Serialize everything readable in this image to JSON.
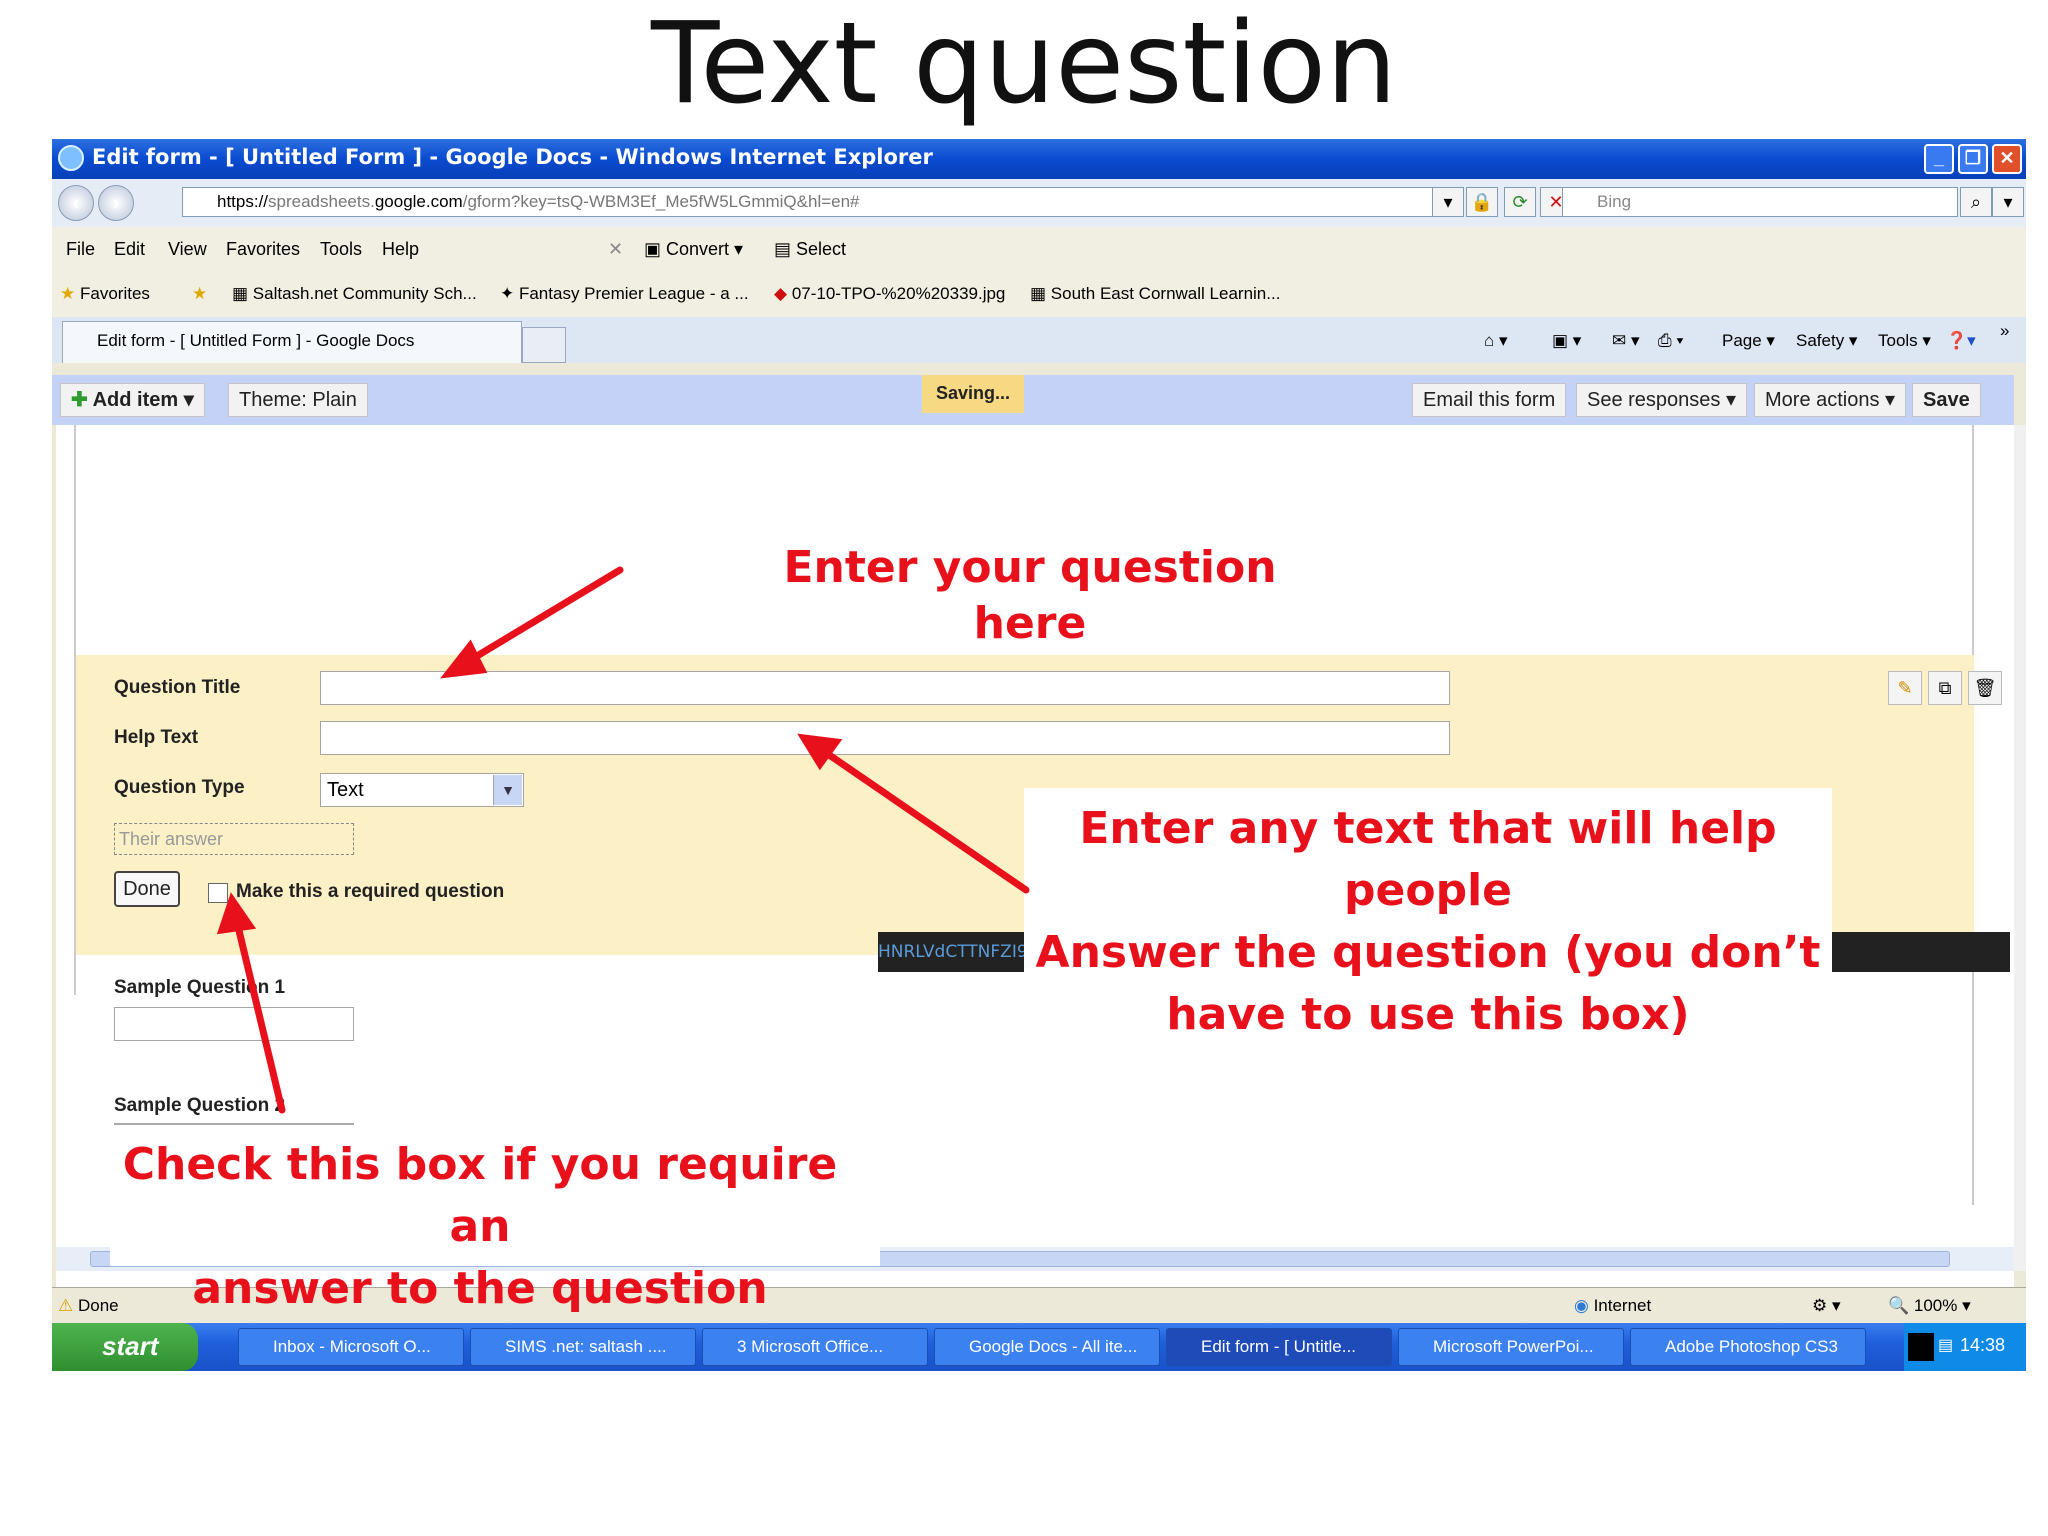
{
  "slide_title": "Text question",
  "window": {
    "title": "Edit form - [ Untitled Form ] - Google Docs - Windows Internet Explorer",
    "minimize_icon": "minimize-icon",
    "maximize_icon": "restore-icon",
    "close_icon": "close-icon"
  },
  "address": {
    "prefix": "https://",
    "host_dim": "spreadsheets.",
    "host": "google.com",
    "path": "/gform?key=tsQ-WBM3Ef_Me5fW5LGmmiQ&hl=en#",
    "search_placeholder": "Bing"
  },
  "menu": [
    "File",
    "Edit",
    "View",
    "Favorites",
    "Tools",
    "Help"
  ],
  "menu_tools": {
    "convert": "Convert",
    "select": "Select"
  },
  "favorites": {
    "label": "Favorites",
    "items": [
      "Saltash.net Community Sch...",
      "Fantasy Premier League - a ...",
      "07-10-TPO-%20%20339.jpg",
      "South East Cornwall Learnin..."
    ]
  },
  "tab": {
    "label": "Edit form - [ Untitled Form ] - Google Docs"
  },
  "command_bar": {
    "page": "Page",
    "safety": "Safety",
    "tools": "Tools"
  },
  "gd_toolbar": {
    "add_item": "Add item",
    "theme_label": "Theme:",
    "theme_value": "Plain",
    "saving": "Saving...",
    "email": "Email this form",
    "responses": "See responses",
    "more": "More actions",
    "save": "Save"
  },
  "question_editor": {
    "title_label": "Question Title",
    "help_label": "Help Text",
    "type_label": "Question Type",
    "type_value": "Text",
    "answer_placeholder": "Their answer",
    "done": "Done",
    "required_label": "Make this a required question"
  },
  "samples": [
    "Sample Question 1",
    "Sample Question 2"
  ],
  "hash_text": "HNRLVdCTTNFZI9NZTVmVzVMR21taVE6MQ",
  "status": {
    "text": "Done",
    "zone": "Internet",
    "zoom": "100%"
  },
  "taskbar": {
    "start": "start",
    "tasks": [
      "Inbox - Microsoft O...",
      "SIMS .net: saltash ....",
      "3 Microsoft Office...",
      "Google Docs - All ite...",
      "Edit form - [ Untitle...",
      "Microsoft PowerPoi...",
      "Adobe Photoshop CS3"
    ],
    "clock": "14:38"
  },
  "annotations": {
    "question": "Enter your question here",
    "help_lines": [
      "Enter any text that will help people",
      "Answer the question (you don’t",
      "have to use this box)"
    ],
    "check_lines": [
      "Check this box if you require an",
      "answer to the question"
    ]
  },
  "colors": {
    "annotation": "#e8101a",
    "titlebar": "#0a4bd0",
    "panel": "#fbf0c6",
    "toolbar": "#c3d2f6",
    "saving": "#f8d983"
  }
}
